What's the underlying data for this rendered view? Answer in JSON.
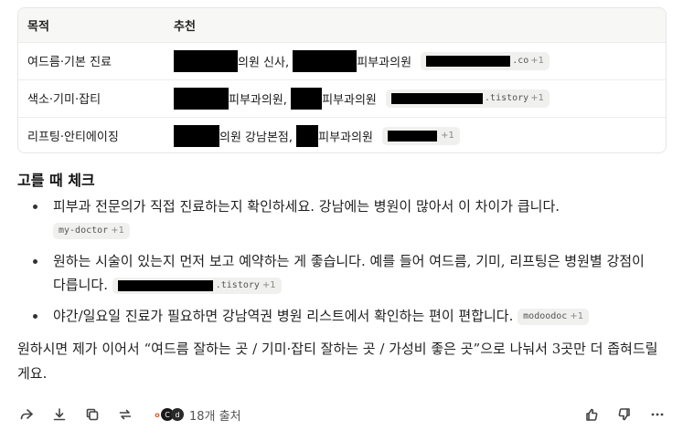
{
  "table": {
    "headers": [
      "목적",
      "추천"
    ],
    "rows": [
      {
        "purpose": "여드름·기본 진료",
        "text1": "의원 신사,",
        "text2": "피부과의원",
        "chip_suffix": ".co",
        "chip_more": "+1"
      },
      {
        "purpose": "색소·기미·잡티",
        "text1": "피부과의원,",
        "text2": "피부과의원",
        "chip_suffix": ".tistory",
        "chip_more": "+1"
      },
      {
        "purpose": "리프팅·안티에이징",
        "text1": "의원 강남본점,",
        "text2": "피부과의원",
        "chip_suffix": "",
        "chip_more": "+1"
      }
    ]
  },
  "section": {
    "title": "고를 때 체크",
    "items": [
      {
        "text": "피부과 전문의가 직접 진료하는지 확인하세요. 강남에는 병원이 많아서 이 차이가 큽니다.",
        "chip": "my-doctor",
        "chip_more": "+1"
      },
      {
        "text": "원하는 시술이 있는지 먼저 보고 예약하는 게 좋습니다. 예를 들어 여드름, 기미, 리프팅은 병원별 강점이 다릅니다.",
        "chip": ".tistory",
        "chip_more": "+1"
      },
      {
        "text": "야간/일요일 진료가 필요하면 강남역권 병원 리스트에서 확인하는 편이 편합니다.",
        "chip": "modoodoc",
        "chip_more": "+1"
      }
    ]
  },
  "closing": "원하시면 제가 이어서 “여드름 잘하는 곳 / 기미·잡티 잘하는 곳 / 가성비 좋은 곳”으로 나눠서 3곳만 더 좁혀드릴게요.",
  "toolbar": {
    "icons": [
      "share-icon",
      "download-icon",
      "copy-icon",
      "regenerate-icon"
    ],
    "sources_label": "18개 출처",
    "right_icons": [
      "thumbs-up-icon",
      "thumbs-down-icon",
      "more-icon"
    ]
  },
  "colors": {
    "redaction": "#000000",
    "chip_bg": "#f0f0ee",
    "header_bg": "#f7f7f5"
  }
}
